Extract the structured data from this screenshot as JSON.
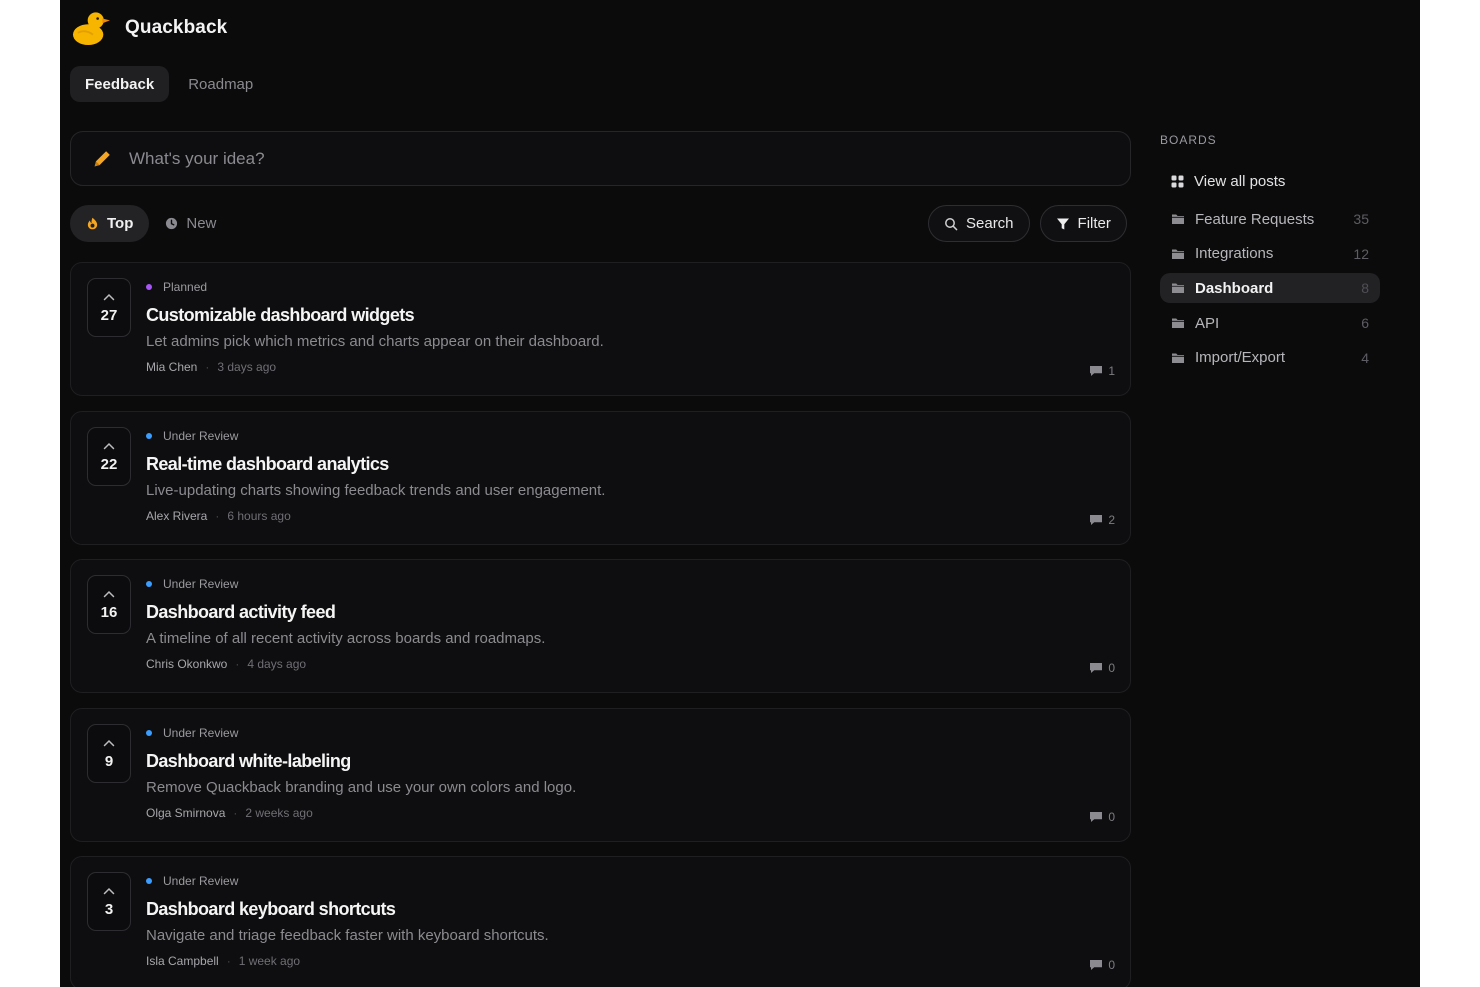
{
  "app": {
    "name": "Quackback",
    "logo_icon": "duck-icon"
  },
  "nav": {
    "tabs": [
      {
        "label": "Feedback",
        "active": true
      },
      {
        "label": "Roadmap",
        "active": false
      }
    ]
  },
  "composer": {
    "placeholder": "What's your idea?",
    "icon": "pencil-icon"
  },
  "sort": {
    "options": [
      {
        "label": "Top",
        "icon": "flame-icon",
        "active": true
      },
      {
        "label": "New",
        "icon": "clock-icon",
        "active": false
      }
    ]
  },
  "tools": {
    "search_label": "Search",
    "filter_label": "Filter"
  },
  "posts": [
    {
      "votes": "27",
      "status": "Planned",
      "status_color": "#a855f7",
      "title": "Customizable dashboard widgets",
      "description": "Let admins pick which metrics and charts appear on their dashboard.",
      "author": "Mia Chen",
      "time": "3 days ago",
      "comments": "1"
    },
    {
      "votes": "22",
      "status": "Under Review",
      "status_color": "#3b9eff",
      "title": "Real-time dashboard analytics",
      "description": "Live-updating charts showing feedback trends and user engagement.",
      "author": "Alex Rivera",
      "time": "6 hours ago",
      "comments": "2"
    },
    {
      "votes": "16",
      "status": "Under Review",
      "status_color": "#3b9eff",
      "title": "Dashboard activity feed",
      "description": "A timeline of all recent activity across boards and roadmaps.",
      "author": "Chris Okonkwo",
      "time": "4 days ago",
      "comments": "0"
    },
    {
      "votes": "9",
      "status": "Under Review",
      "status_color": "#3b9eff",
      "title": "Dashboard white-labeling",
      "description": "Remove Quackback branding and use your own colors and logo.",
      "author": "Olga Smirnova",
      "time": "2 weeks ago",
      "comments": "0"
    },
    {
      "votes": "3",
      "status": "Under Review",
      "status_color": "#3b9eff",
      "title": "Dashboard keyboard shortcuts",
      "description": "Navigate and triage feedback faster with keyboard shortcuts.",
      "author": "Isla Campbell",
      "time": "1 week ago",
      "comments": "0"
    }
  ],
  "sidebar": {
    "heading": "BOARDS",
    "view_all_label": "View all posts",
    "boards": [
      {
        "label": "Feature Requests",
        "count": "35",
        "active": false
      },
      {
        "label": "Integrations",
        "count": "12",
        "active": false
      },
      {
        "label": "Dashboard",
        "count": "8",
        "active": true
      },
      {
        "label": "API",
        "count": "6",
        "active": false
      },
      {
        "label": "Import/Export",
        "count": "4",
        "active": false
      }
    ]
  },
  "colors": {
    "accent_orange": "#f5a623",
    "background": "#0b0b0c",
    "card": "#0e0e10"
  }
}
